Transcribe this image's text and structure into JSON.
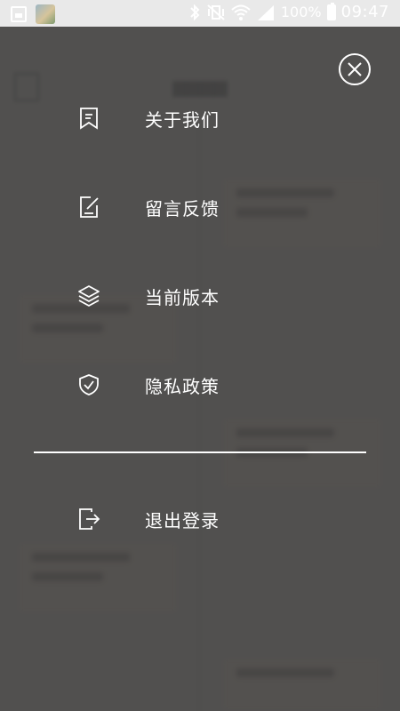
{
  "status_bar": {
    "battery_text": "100%",
    "time": "09:47"
  },
  "menu": {
    "items": [
      {
        "label": "关于我们",
        "icon": "bookmark-icon"
      },
      {
        "label": "留言反馈",
        "icon": "edit-note-icon"
      },
      {
        "label": "当前版本",
        "icon": "layers-icon"
      },
      {
        "label": "隐私政策",
        "icon": "shield-check-icon"
      }
    ],
    "logout": {
      "label": "退出登录",
      "icon": "logout-icon"
    }
  },
  "colors": {
    "overlay": "#5f5f5f",
    "text": "#ffffff",
    "status_bar_bg": "#e9e9e9"
  }
}
